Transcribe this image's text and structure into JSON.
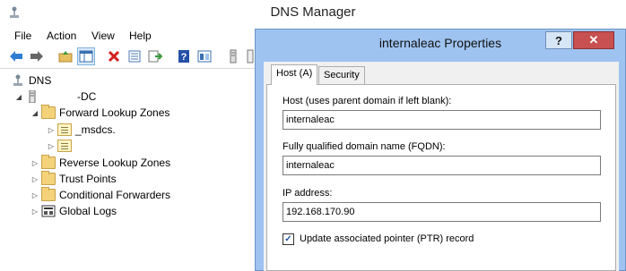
{
  "window": {
    "title": "DNS Manager"
  },
  "menu": [
    "File",
    "Action",
    "View",
    "Help"
  ],
  "toolbar": [
    {
      "icon": "back-arrow-icon",
      "color": "#2f7dd1"
    },
    {
      "icon": "forward-arrow-icon",
      "color": "#555555"
    },
    {
      "icon": "up-folder-icon",
      "color": "#d9a93a"
    },
    {
      "icon": "show-hide-tree-icon",
      "color": "#3a6fb0"
    },
    {
      "icon": "delete-icon",
      "color": "#d32020"
    },
    {
      "icon": "properties-icon",
      "color": "#4a7ab8"
    },
    {
      "icon": "export-list-icon",
      "color": "#3a9a3a"
    },
    {
      "icon": "help-icon",
      "color": "#2650a8"
    },
    {
      "icon": "view-icon",
      "color": "#3a6fb0"
    },
    {
      "icon": "server-icon",
      "color": "#777777"
    },
    {
      "icon": "record-icon",
      "color": "#777777"
    }
  ],
  "tree": {
    "root": "DNS",
    "server": "-DC",
    "forward_zones": "Forward Lookup Zones",
    "msdcs": "_msdcs.",
    "reverse_zones": "Reverse Lookup Zones",
    "trust_points": "Trust Points",
    "conditional_forwarders": "Conditional Forwarders",
    "global_logs": "Global Logs"
  },
  "dialog": {
    "title": "internaleac Properties",
    "help_label": "?",
    "close_label": "✕",
    "tabs": [
      "Host (A)",
      "Security"
    ],
    "host_label": "Host (uses parent domain if left blank):",
    "host_value": "internaleac",
    "fqdn_label": "Fully qualified domain name (FQDN):",
    "fqdn_value": "internaleac",
    "ip_label": "IP address:",
    "ip_value": "192.168.170.90",
    "ptr_label": "Update associated pointer (PTR) record",
    "ptr_checked": true
  }
}
